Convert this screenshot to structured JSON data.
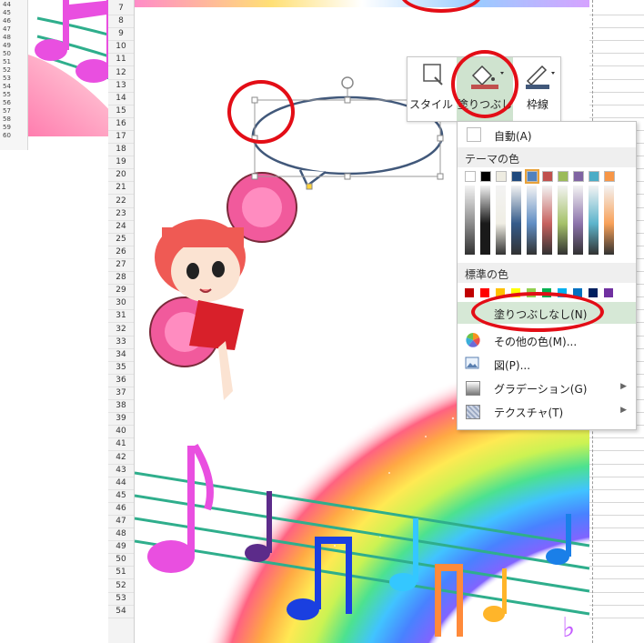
{
  "thumbnail": {
    "row_numbers": [
      "44",
      "45",
      "46",
      "47",
      "48",
      "49",
      "50",
      "51",
      "52",
      "53",
      "54",
      "55",
      "56",
      "57",
      "58",
      "59",
      "60"
    ]
  },
  "sheet": {
    "row_numbers": [
      "7",
      "8",
      "9",
      "10",
      "11",
      "12",
      "13",
      "14",
      "15",
      "16",
      "17",
      "18",
      "19",
      "20",
      "21",
      "22",
      "23",
      "24",
      "25",
      "26",
      "27",
      "28",
      "29",
      "30",
      "31",
      "32",
      "33",
      "34",
      "35",
      "36",
      "37",
      "38",
      "39",
      "40",
      "41",
      "42",
      "43",
      "44",
      "45",
      "46",
      "47",
      "48",
      "49",
      "50",
      "51",
      "52",
      "53",
      "54"
    ]
  },
  "mini_toolbar": {
    "style_label": "スタイル",
    "fill_label": "塗りつぶし",
    "outline_label": "枠線"
  },
  "fill_menu": {
    "auto_label": "自動(A)",
    "theme_colors_label": "テーマの色",
    "standard_colors_label": "標準の色",
    "no_fill_label": "塗りつぶしなし(N)",
    "more_colors_label": "その他の色(M)...",
    "picture_label": "図(P)...",
    "gradient_label": "グラデーション(G)",
    "texture_label": "テクスチャ(T)",
    "theme_top_colors": [
      "#ffffff",
      "#000000",
      "#e7e6e6",
      "#44546a",
      "#4472c4",
      "#ed7d31",
      "#a5a5a5",
      "#ffc000",
      "#5b9bd5",
      "#70ad47"
    ],
    "theme_row_top": [
      "#ffffff",
      "#000000",
      "#eeece1",
      "#1f497d",
      "#4f81bd",
      "#c0504d",
      "#9bbb59",
      "#8064a2",
      "#4bacc6",
      "#f79646"
    ],
    "standard_colors": [
      "#c00000",
      "#ff0000",
      "#ffc000",
      "#ffff00",
      "#92d050",
      "#00b050",
      "#00b0f0",
      "#0070c0",
      "#002060",
      "#7030a0"
    ]
  },
  "accent": {
    "highlight": "#e30d16",
    "fill_button_bg": "#cfe3cf",
    "shape_outline": "#41587a"
  }
}
